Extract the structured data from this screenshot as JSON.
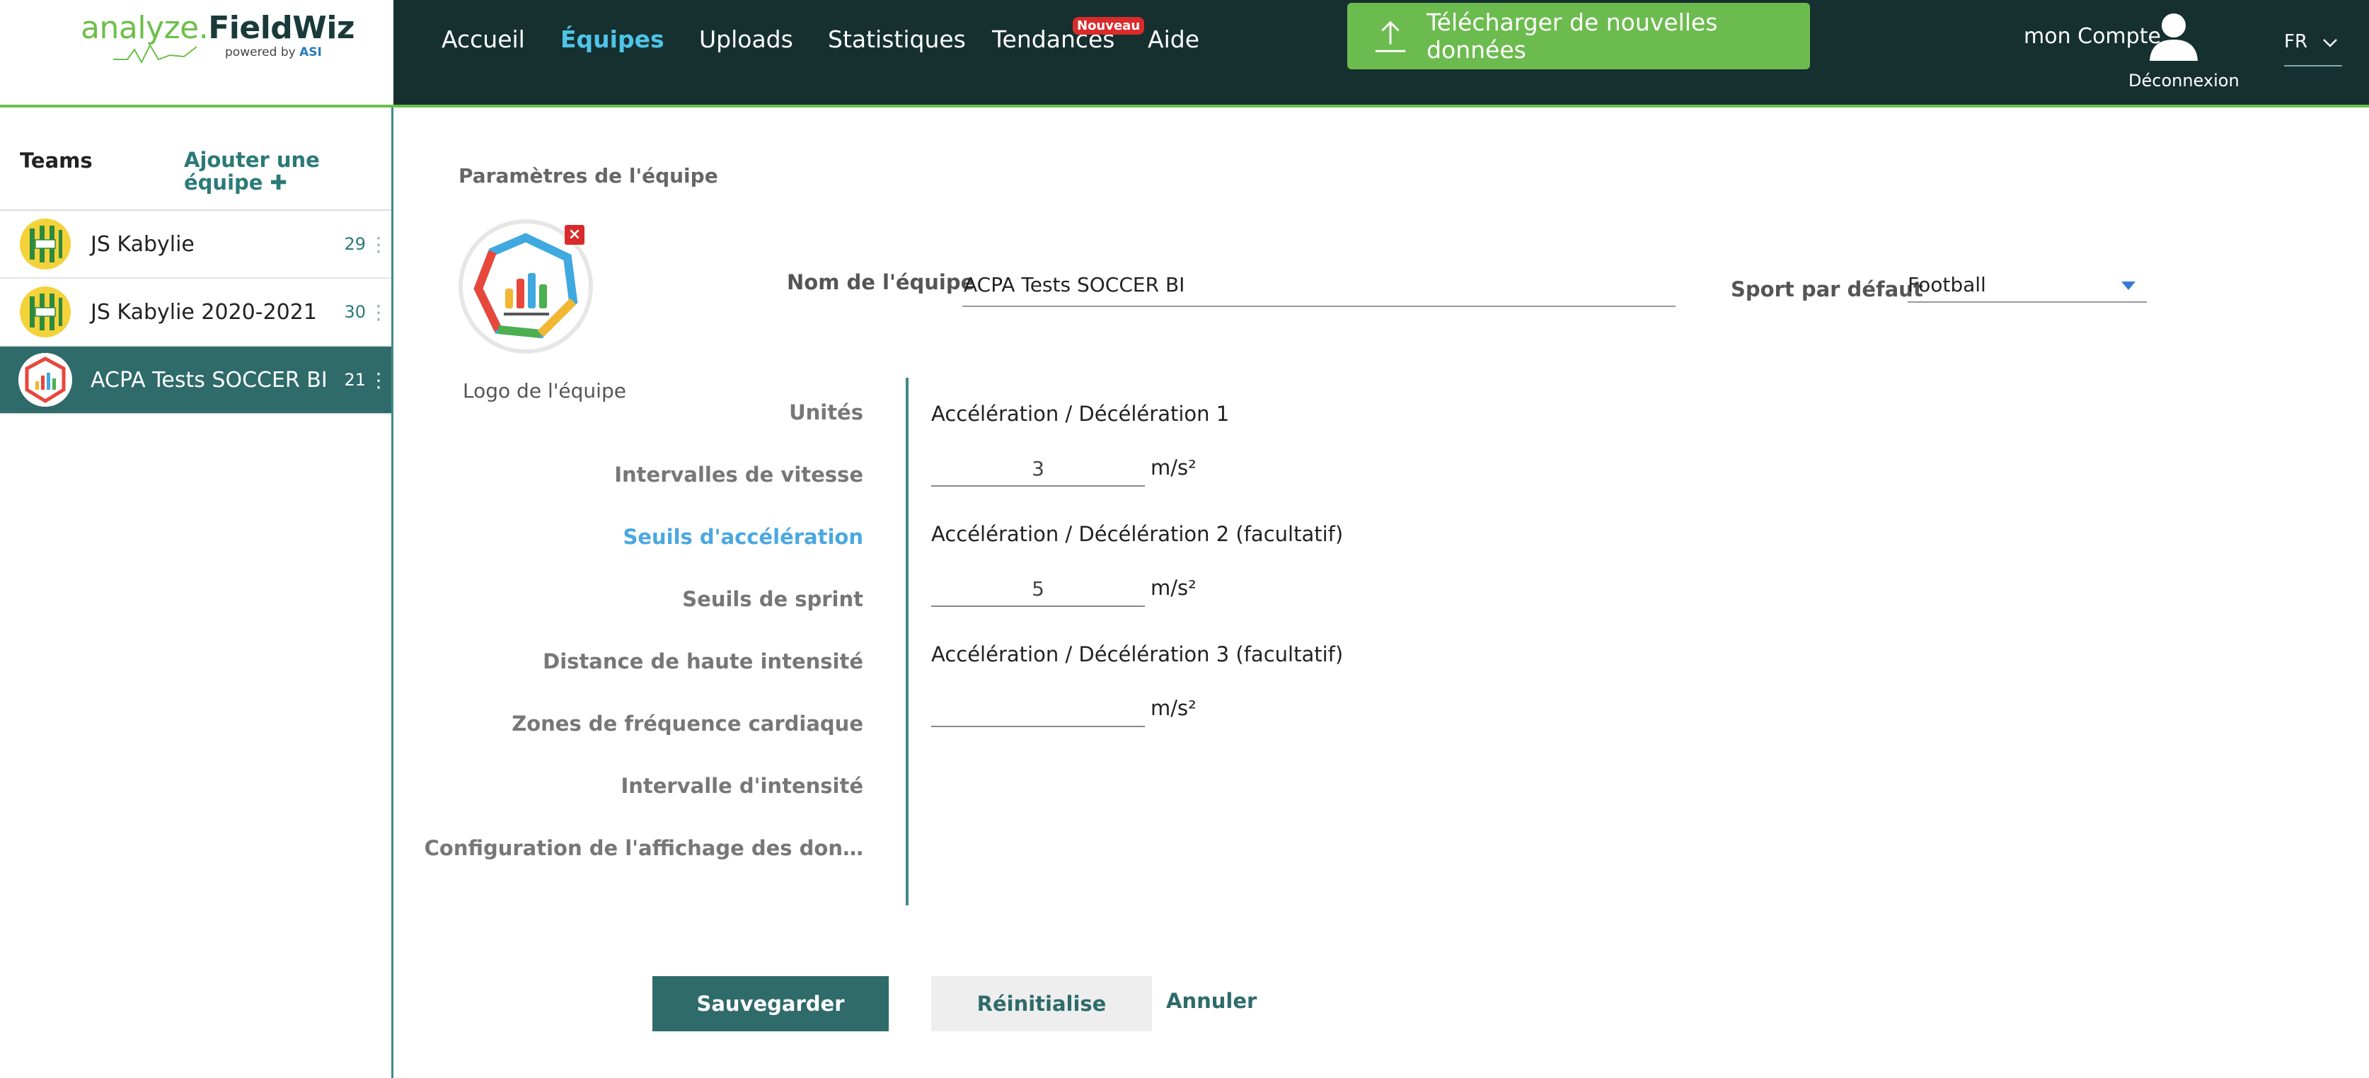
{
  "brand": {
    "name_part1": "analyze.",
    "name_part2": "FieldWiz",
    "powered_by": "powered by",
    "powered_by_brand": "ASI"
  },
  "nav": {
    "items": [
      {
        "label": "Accueil",
        "active": false
      },
      {
        "label": "Équipes",
        "active": true
      },
      {
        "label": "Uploads",
        "active": false
      },
      {
        "label": "Statistiques",
        "active": false
      },
      {
        "label": "Tendances",
        "active": false
      },
      {
        "label": "Aide",
        "active": false
      }
    ],
    "new_badge": "Nouveau",
    "upload_button": "Télécharger de nouvelles données",
    "account": "mon Compte",
    "logout": "Déconnexion",
    "language": "FR"
  },
  "sidebar": {
    "title": "Teams",
    "add_team": "Ajouter une équipe ✚",
    "teams": [
      {
        "name": "JS Kabylie",
        "count": "29",
        "selected": false
      },
      {
        "name": "JS Kabylie 2020-2021",
        "count": "30",
        "selected": false
      },
      {
        "name": "ACPA Tests SOCCER BI",
        "count": "21",
        "selected": true
      }
    ]
  },
  "settings": {
    "section_title": "Paramètres de l'équipe",
    "logo_caption": "Logo de l'équipe",
    "team_name_label": "Nom de l'équipe",
    "team_name_value": "ACPA Tests SOCCER BI",
    "sport_label": "Sport par défaut",
    "sport_value": "Football",
    "menu": [
      {
        "label": "Unités",
        "active": false
      },
      {
        "label": "Intervalles de vitesse",
        "active": false
      },
      {
        "label": "Seuils d'accélération",
        "active": true
      },
      {
        "label": "Seuils de sprint",
        "active": false
      },
      {
        "label": "Distance de haute intensité",
        "active": false
      },
      {
        "label": "Zones de fréquence cardiaque",
        "active": false
      },
      {
        "label": "Intervalle d'intensité",
        "active": false
      },
      {
        "label": "Configuration de l'affichage des don…",
        "active": false
      }
    ],
    "thresholds": [
      {
        "label": "Accélération / Décélération 1",
        "value": "3",
        "unit": "m/s²"
      },
      {
        "label": "Accélération / Décélération 2  (facultatif)",
        "value": "5",
        "unit": "m/s²"
      },
      {
        "label": "Accélération / Décélération 3  (facultatif)",
        "value": "",
        "unit": "m/s²"
      }
    ]
  },
  "actions": {
    "save": "Sauvegarder",
    "reset": "Réinitialise",
    "cancel": "Annuler"
  },
  "colors": {
    "header_bg": "#15302f",
    "accent_green": "#6cbb4f",
    "teal": "#2e6b6a",
    "active_blue": "#4aa8e0",
    "nav_active": "#4fc3e8",
    "badge_red": "#d92b2b"
  }
}
